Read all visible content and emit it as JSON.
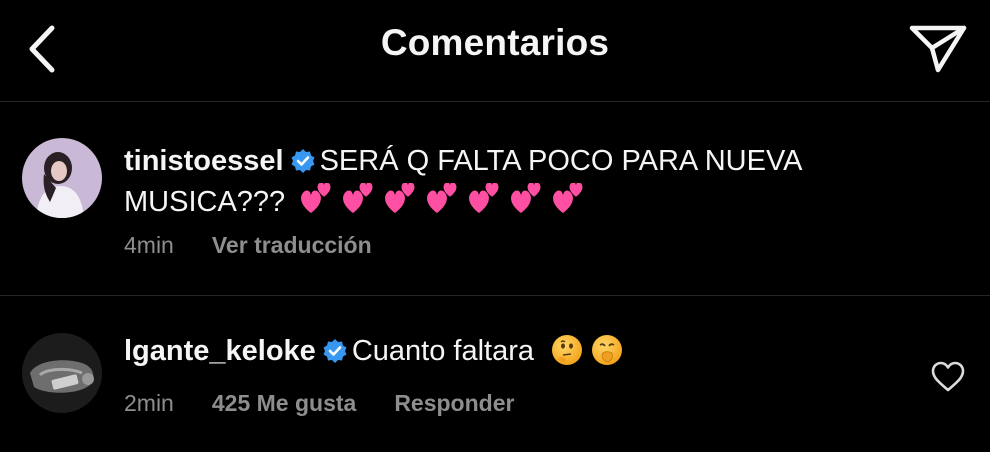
{
  "header": {
    "title": "Comentarios",
    "back_icon": "chevron-left-icon",
    "share_icon": "paper-plane-icon"
  },
  "comments": [
    {
      "username": "tinistoessel",
      "verified": true,
      "text_line1": "SERÁ Q FALTA POCO PARA NUEVA",
      "text_line2": "MUSICA???",
      "emoji": "two-hearts x7",
      "time": "4min",
      "action": "Ver traducción"
    },
    {
      "username": "lgante_keloke",
      "verified": true,
      "text": "Cuanto faltara",
      "emoji": "thinking-face, face-with-hand-over-mouth",
      "time": "2min",
      "likes": "425 Me gusta",
      "action": "Responder"
    }
  ],
  "colors": {
    "background": "#000000",
    "text": "#f5f5f5",
    "meta": "#8e8e8e",
    "verified": "#3897f0",
    "hearts": "#ff4fa3"
  }
}
